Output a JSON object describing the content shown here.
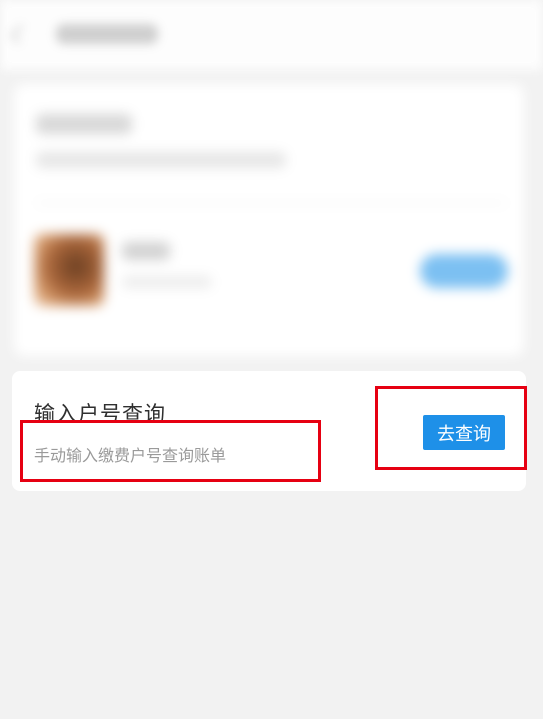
{
  "colors": {
    "page_background": "#f2f2f2",
    "primary_button": "#1e90e8",
    "highlight_box": "#e60012"
  },
  "icons": {
    "back": "chevron-left-icon"
  },
  "query_card": {
    "title": "输入户号查询",
    "subtitle": "手动输入缴费户号查询账单",
    "button_label": "去查询"
  }
}
